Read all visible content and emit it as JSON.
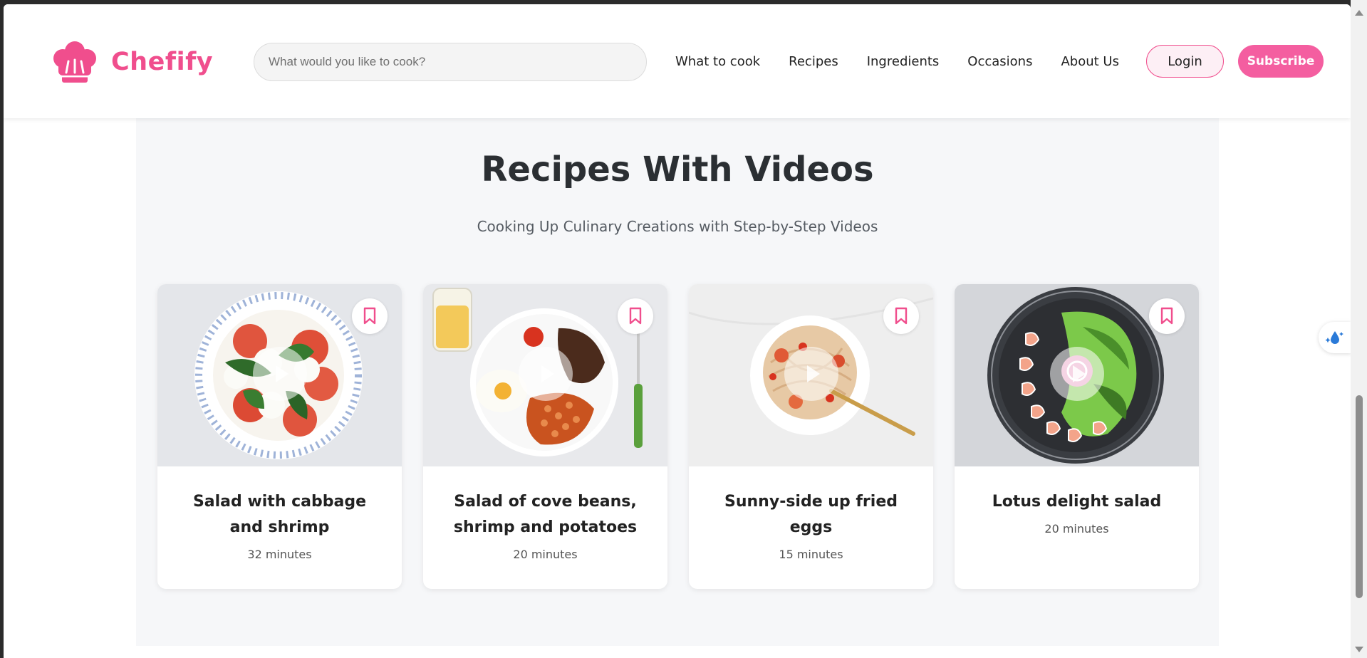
{
  "brand": {
    "name": "Chefify",
    "color": "#f04e8d"
  },
  "search": {
    "placeholder": "What would you like to cook?"
  },
  "nav": [
    {
      "label": "What to cook"
    },
    {
      "label": "Recipes"
    },
    {
      "label": "Ingredients"
    },
    {
      "label": "Occasions"
    },
    {
      "label": "About Us"
    }
  ],
  "actions": {
    "login_label": "Login",
    "subscribe_label": "Subscribe"
  },
  "section": {
    "title": "Recipes With Videos",
    "subtitle": "Cooking Up Culinary Creations with Step-by-Step Videos"
  },
  "recipes": [
    {
      "title": "Salad with cabbage and shrimp",
      "time": "32 minutes",
      "icons": [
        "bookmark-icon",
        "play-icon"
      ]
    },
    {
      "title": "Salad of cove beans, shrimp and potatoes",
      "time": "20 minutes",
      "icons": [
        "bookmark-icon",
        "play-icon"
      ]
    },
    {
      "title": "Sunny-side up fried eggs",
      "time": "15 minutes",
      "icons": [
        "bookmark-icon",
        "play-icon"
      ]
    },
    {
      "title": "Lotus delight salad",
      "time": "20 minutes",
      "icons": [
        "bookmark-icon",
        "play-icon"
      ]
    }
  ]
}
